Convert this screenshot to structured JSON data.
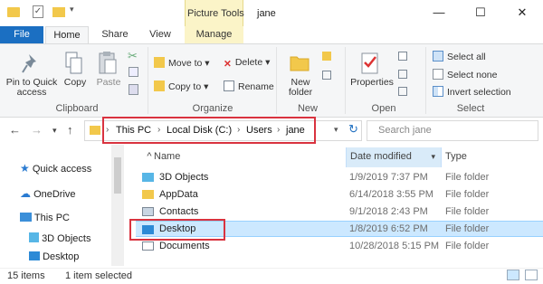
{
  "titlebar": {
    "context_group": "Picture Tools",
    "window_title": "jane",
    "minimize": "—",
    "maximize": "☐",
    "close": "✕"
  },
  "tabs": {
    "file": "File",
    "home": "Home",
    "share": "Share",
    "view": "View",
    "manage": "Manage"
  },
  "ribbon": {
    "clipboard": {
      "pin_to_quick_access": [
        "Pin to Quick",
        "access"
      ],
      "copy": "Copy",
      "paste": "Paste",
      "label": "Clipboard"
    },
    "organize": {
      "move_to": "Move to",
      "copy_to": "Copy to",
      "delete": "Delete",
      "rename": "Rename",
      "label": "Organize"
    },
    "new": {
      "new_folder": [
        "New",
        "folder"
      ],
      "label": "New"
    },
    "open": {
      "properties": "Properties",
      "label": "Open"
    },
    "select": {
      "select_all": "Select all",
      "select_none": "Select none",
      "invert_selection": "Invert selection",
      "label": "Select"
    }
  },
  "address": {
    "segments": [
      "This PC",
      "Local Disk (C:)",
      "Users",
      "jane"
    ],
    "search_placeholder": "Search jane"
  },
  "nav_pane": {
    "items": [
      {
        "label": "Quick access",
        "icon": "star-icon"
      },
      {
        "label": "OneDrive",
        "icon": "cloud-icon"
      },
      {
        "label": "This PC",
        "icon": "computer-icon"
      },
      {
        "label": "3D Objects",
        "icon": "cube-icon"
      },
      {
        "label": "Desktop",
        "icon": "desktop-icon"
      }
    ]
  },
  "file_list": {
    "columns": {
      "name": "Name",
      "date": "Date modified",
      "type": "Type"
    },
    "rows": [
      {
        "name": "3D Objects",
        "date": "1/9/2019 7:37 PM",
        "type": "File folder",
        "icon": "cube-icon"
      },
      {
        "name": "AppData",
        "date": "6/14/2018 3:55 PM",
        "type": "File folder",
        "icon": "folder-icon"
      },
      {
        "name": "Contacts",
        "date": "9/1/2018 2:43 PM",
        "type": "File folder",
        "icon": "contacts-icon"
      },
      {
        "name": "Desktop",
        "date": "1/8/2019 6:52 PM",
        "type": "File folder",
        "icon": "desktop-icon"
      },
      {
        "name": "Documents",
        "date": "10/28/2018 5:15 PM",
        "type": "File folder",
        "icon": "documents-icon"
      }
    ]
  },
  "status": {
    "item_count": "15 items",
    "selected": "1 item selected"
  },
  "colors": {
    "accent": "#1b6fc2",
    "highlight": "#d9333f",
    "selection": "#cce8ff",
    "context_tab": "#fbf4c8"
  }
}
